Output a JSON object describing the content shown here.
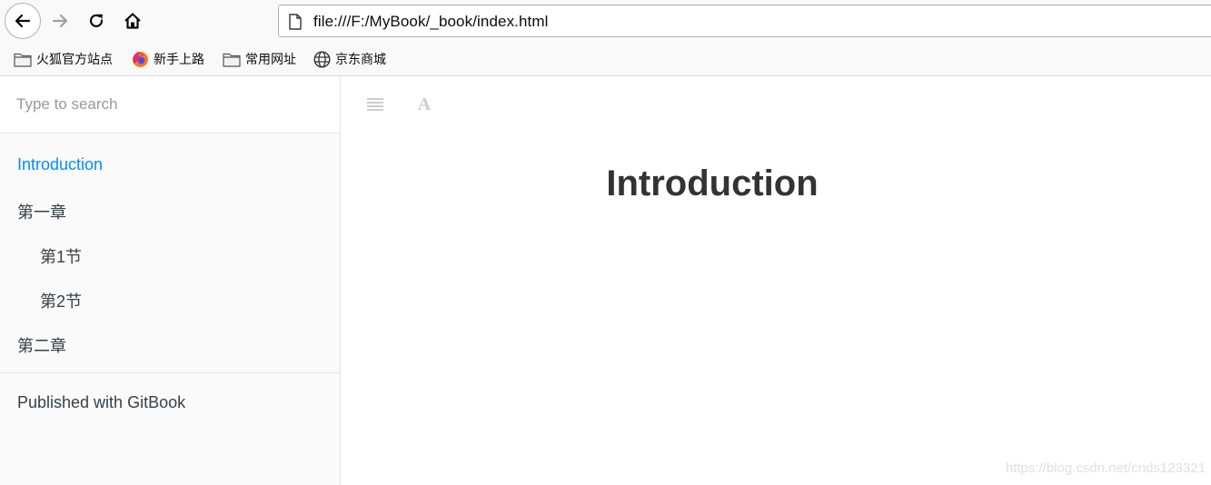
{
  "browser": {
    "url": "file:///F:/MyBook/_book/index.html",
    "bookmarks": [
      {
        "label": "火狐官方站点",
        "icon": "folder-icon"
      },
      {
        "label": "新手上路",
        "icon": "firefox-icon"
      },
      {
        "label": "常用网址",
        "icon": "folder-icon"
      },
      {
        "label": "京东商城",
        "icon": "globe-icon"
      }
    ]
  },
  "sidebar": {
    "search_placeholder": "Type to search",
    "toc": [
      {
        "label": "Introduction",
        "active": true
      },
      {
        "label": "第一章"
      },
      {
        "label": "第1节"
      },
      {
        "label": "第2节"
      },
      {
        "label": "第二章"
      }
    ],
    "published": "Published with GitBook"
  },
  "header": {
    "font_label": "A"
  },
  "content": {
    "title": "Introduction"
  },
  "watermark": "https://blog.csdn.net/cnds123321",
  "colors": {
    "active_link": "#008cff",
    "text": "#364149",
    "title": "#333333"
  }
}
